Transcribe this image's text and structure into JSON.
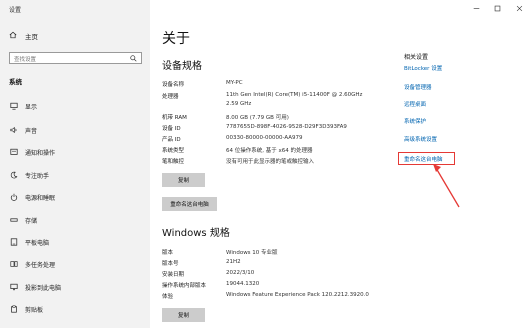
{
  "window": {
    "title": "设置",
    "controls": [
      "minimize-icon",
      "maximize-icon",
      "close-icon"
    ]
  },
  "sidebar": {
    "home_label": "主页",
    "search_placeholder": "查找设置",
    "section_label": "系统",
    "items": [
      {
        "label": "显示",
        "icon": "monitor-icon"
      },
      {
        "label": "声音",
        "icon": "speaker-icon"
      },
      {
        "label": "通知和操作",
        "icon": "notification-icon"
      },
      {
        "label": "专注助手",
        "icon": "moon-icon"
      },
      {
        "label": "电源和睡眠",
        "icon": "power-icon"
      },
      {
        "label": "存储",
        "icon": "storage-icon"
      },
      {
        "label": "平板电脑",
        "icon": "tablet-icon"
      },
      {
        "label": "多任务处理",
        "icon": "multitask-icon"
      },
      {
        "label": "投影到此电脑",
        "icon": "project-icon"
      },
      {
        "label": "剪贴板",
        "icon": "clipboard-icon"
      }
    ]
  },
  "main": {
    "title": "关于",
    "device_spec_title": "设备规格",
    "device_specs": [
      {
        "label": "设备名称",
        "value": "MY-PC"
      },
      {
        "label": "处理器",
        "value": "11th Gen Intel(R) Core(TM) i5-11400F @ 2.60GHz",
        "value2": "2.59 GHz"
      },
      {
        "label": "机带 RAM",
        "value": "8.00 GB (7.79 GB 可用)"
      },
      {
        "label": "设备 ID",
        "value": "7787655D-898F-4026-9528-D29F3D393FA9"
      },
      {
        "label": "产品 ID",
        "value": "00330-80000-00000-AA979"
      },
      {
        "label": "系统类型",
        "value": "64 位操作系统, 基于 x64 的处理器"
      },
      {
        "label": "笔和触控",
        "value": "没有可用于此显示器的笔或触控输入"
      }
    ],
    "copy_button": "复制",
    "rename_button": "重命名这台电脑",
    "windows_spec_title": "Windows 规格",
    "windows_specs": [
      {
        "label": "版本",
        "value": "Windows 10 专业版"
      },
      {
        "label": "版本号",
        "value": "21H2"
      },
      {
        "label": "安装日期",
        "value": "2022/3/10"
      },
      {
        "label": "操作系统内部版本",
        "value": "19044.1320"
      },
      {
        "label": "体验",
        "value": "Windows Feature Experience Pack 120.2212.3920.0"
      }
    ],
    "copy_button_2": "复制"
  },
  "related": {
    "title": "相关设置",
    "links": [
      "BitLocker 设置",
      "设备管理器",
      "远程桌面",
      "系统保护",
      "高级系统设置",
      "重命名这台电脑"
    ]
  },
  "annotation": {
    "color": "#e53935"
  }
}
